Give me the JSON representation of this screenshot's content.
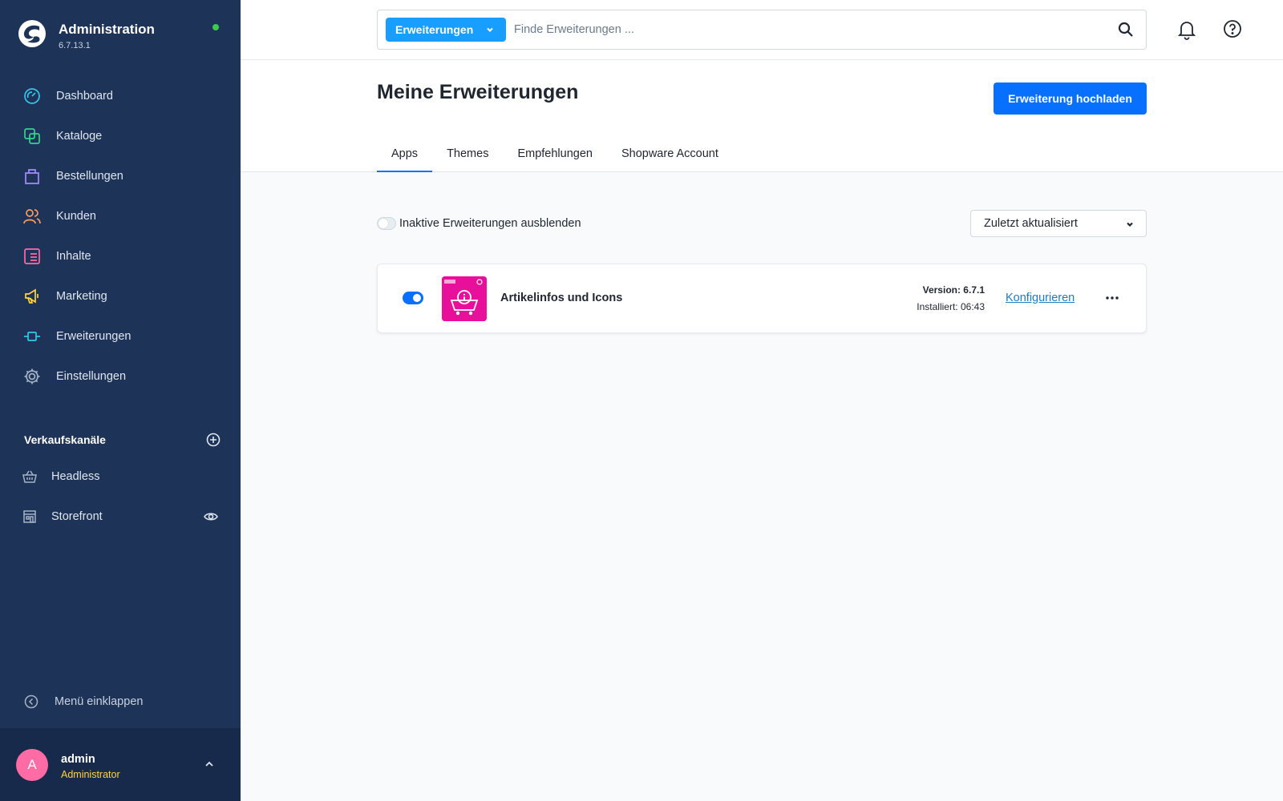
{
  "app": {
    "title": "Administration",
    "version": "6.7.13.1"
  },
  "nav": [
    {
      "label": "Dashboard",
      "icon": "dashboard-icon"
    },
    {
      "label": "Kataloge",
      "icon": "catalog-icon"
    },
    {
      "label": "Bestellungen",
      "icon": "orders-icon"
    },
    {
      "label": "Kunden",
      "icon": "customers-icon"
    },
    {
      "label": "Inhalte",
      "icon": "content-icon"
    },
    {
      "label": "Marketing",
      "icon": "marketing-icon"
    },
    {
      "label": "Erweiterungen",
      "icon": "extensions-icon"
    },
    {
      "label": "Einstellungen",
      "icon": "settings-icon"
    }
  ],
  "sales_channels": {
    "heading": "Verkaufskanäle",
    "items": [
      {
        "label": "Headless",
        "icon": "basket-icon"
      },
      {
        "label": "Storefront",
        "icon": "storefront-icon"
      }
    ]
  },
  "collapse_label": "Menü einklappen",
  "user": {
    "initial": "A",
    "name": "admin",
    "role": "Administrator"
  },
  "search": {
    "type_label": "Erweiterungen",
    "placeholder": "Finde Erweiterungen ..."
  },
  "page": {
    "title": "Meine Erweiterungen",
    "upload_label": "Erweiterung hochladen",
    "tabs": [
      "Apps",
      "Themes",
      "Empfehlungen",
      "Shopware Account"
    ],
    "active_tab": "Apps"
  },
  "filter": {
    "hide_inactive_label": "Inaktive Erweiterungen ausblenden",
    "hide_inactive": false,
    "sort_label": "Zuletzt aktualisiert"
  },
  "extensions": [
    {
      "name": "Artikelinfos und Icons",
      "active": true,
      "version": "Version: 6.7.1",
      "installed": "Installiert: 06:43",
      "configure_label": "Konfigurieren"
    }
  ],
  "colors": {
    "sidebar": "#1e3358",
    "accent": "#0870ff",
    "search_type": "#189eff",
    "extension_icon": "#e8109a",
    "status_online": "#37d046"
  }
}
